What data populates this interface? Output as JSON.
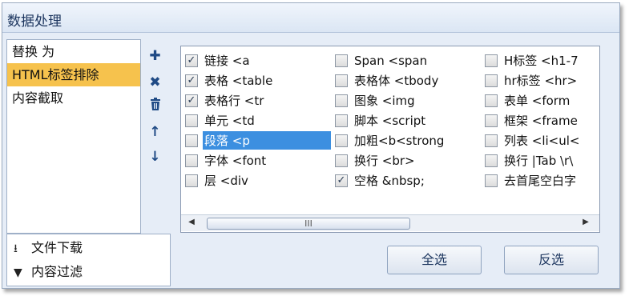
{
  "window": {
    "title": "数据处理"
  },
  "left_list": {
    "items": [
      "替换  为",
      "HTML标签排除",
      "内容截取"
    ],
    "selected_index": 1
  },
  "toolbar": {
    "icons": [
      "plus-icon",
      "close-icon",
      "trash-icon",
      "arrow-up-icon",
      "arrow-down-icon"
    ]
  },
  "links": {
    "download": "文件下载",
    "filter": "内容过滤"
  },
  "checklist": {
    "col1": [
      {
        "label": "链接 <a",
        "checked": true
      },
      {
        "label": "表格 <table",
        "checked": true
      },
      {
        "label": "表格行 <tr",
        "checked": true
      },
      {
        "label": "单元 <td",
        "checked": false
      },
      {
        "label": "段落 <p",
        "checked": false,
        "highlighted": true
      },
      {
        "label": "字体 <font",
        "checked": false
      },
      {
        "label": "层 <div",
        "checked": false
      }
    ],
    "col2": [
      {
        "label": "Span <span",
        "checked": false
      },
      {
        "label": "表格体 <tbody",
        "checked": false
      },
      {
        "label": "图象 <img",
        "checked": false
      },
      {
        "label": "脚本 <script",
        "checked": false
      },
      {
        "label": "加粗<b<strong",
        "checked": false
      },
      {
        "label": "换行 <br>",
        "checked": false
      },
      {
        "label": "空格 &nbsp;",
        "checked": true
      }
    ],
    "col3": [
      {
        "label": "H标签 <h1-7",
        "checked": false
      },
      {
        "label": "hr标签 <hr>",
        "checked": false
      },
      {
        "label": "表单 <form",
        "checked": false
      },
      {
        "label": "框架 <frame",
        "checked": false
      },
      {
        "label": "列表 <li<ul<",
        "checked": false
      },
      {
        "label": "换行 |Tab \\r\\",
        "checked": false
      },
      {
        "label": "去首尾空白字",
        "checked": false
      }
    ]
  },
  "scrollbar": {
    "thumb_grip": "III"
  },
  "buttons": {
    "select_all": "全选",
    "invert": "反选"
  },
  "colors": {
    "selection": "#f6c24d",
    "highlight": "#3c8fe0",
    "accent": "#1f4a85"
  }
}
